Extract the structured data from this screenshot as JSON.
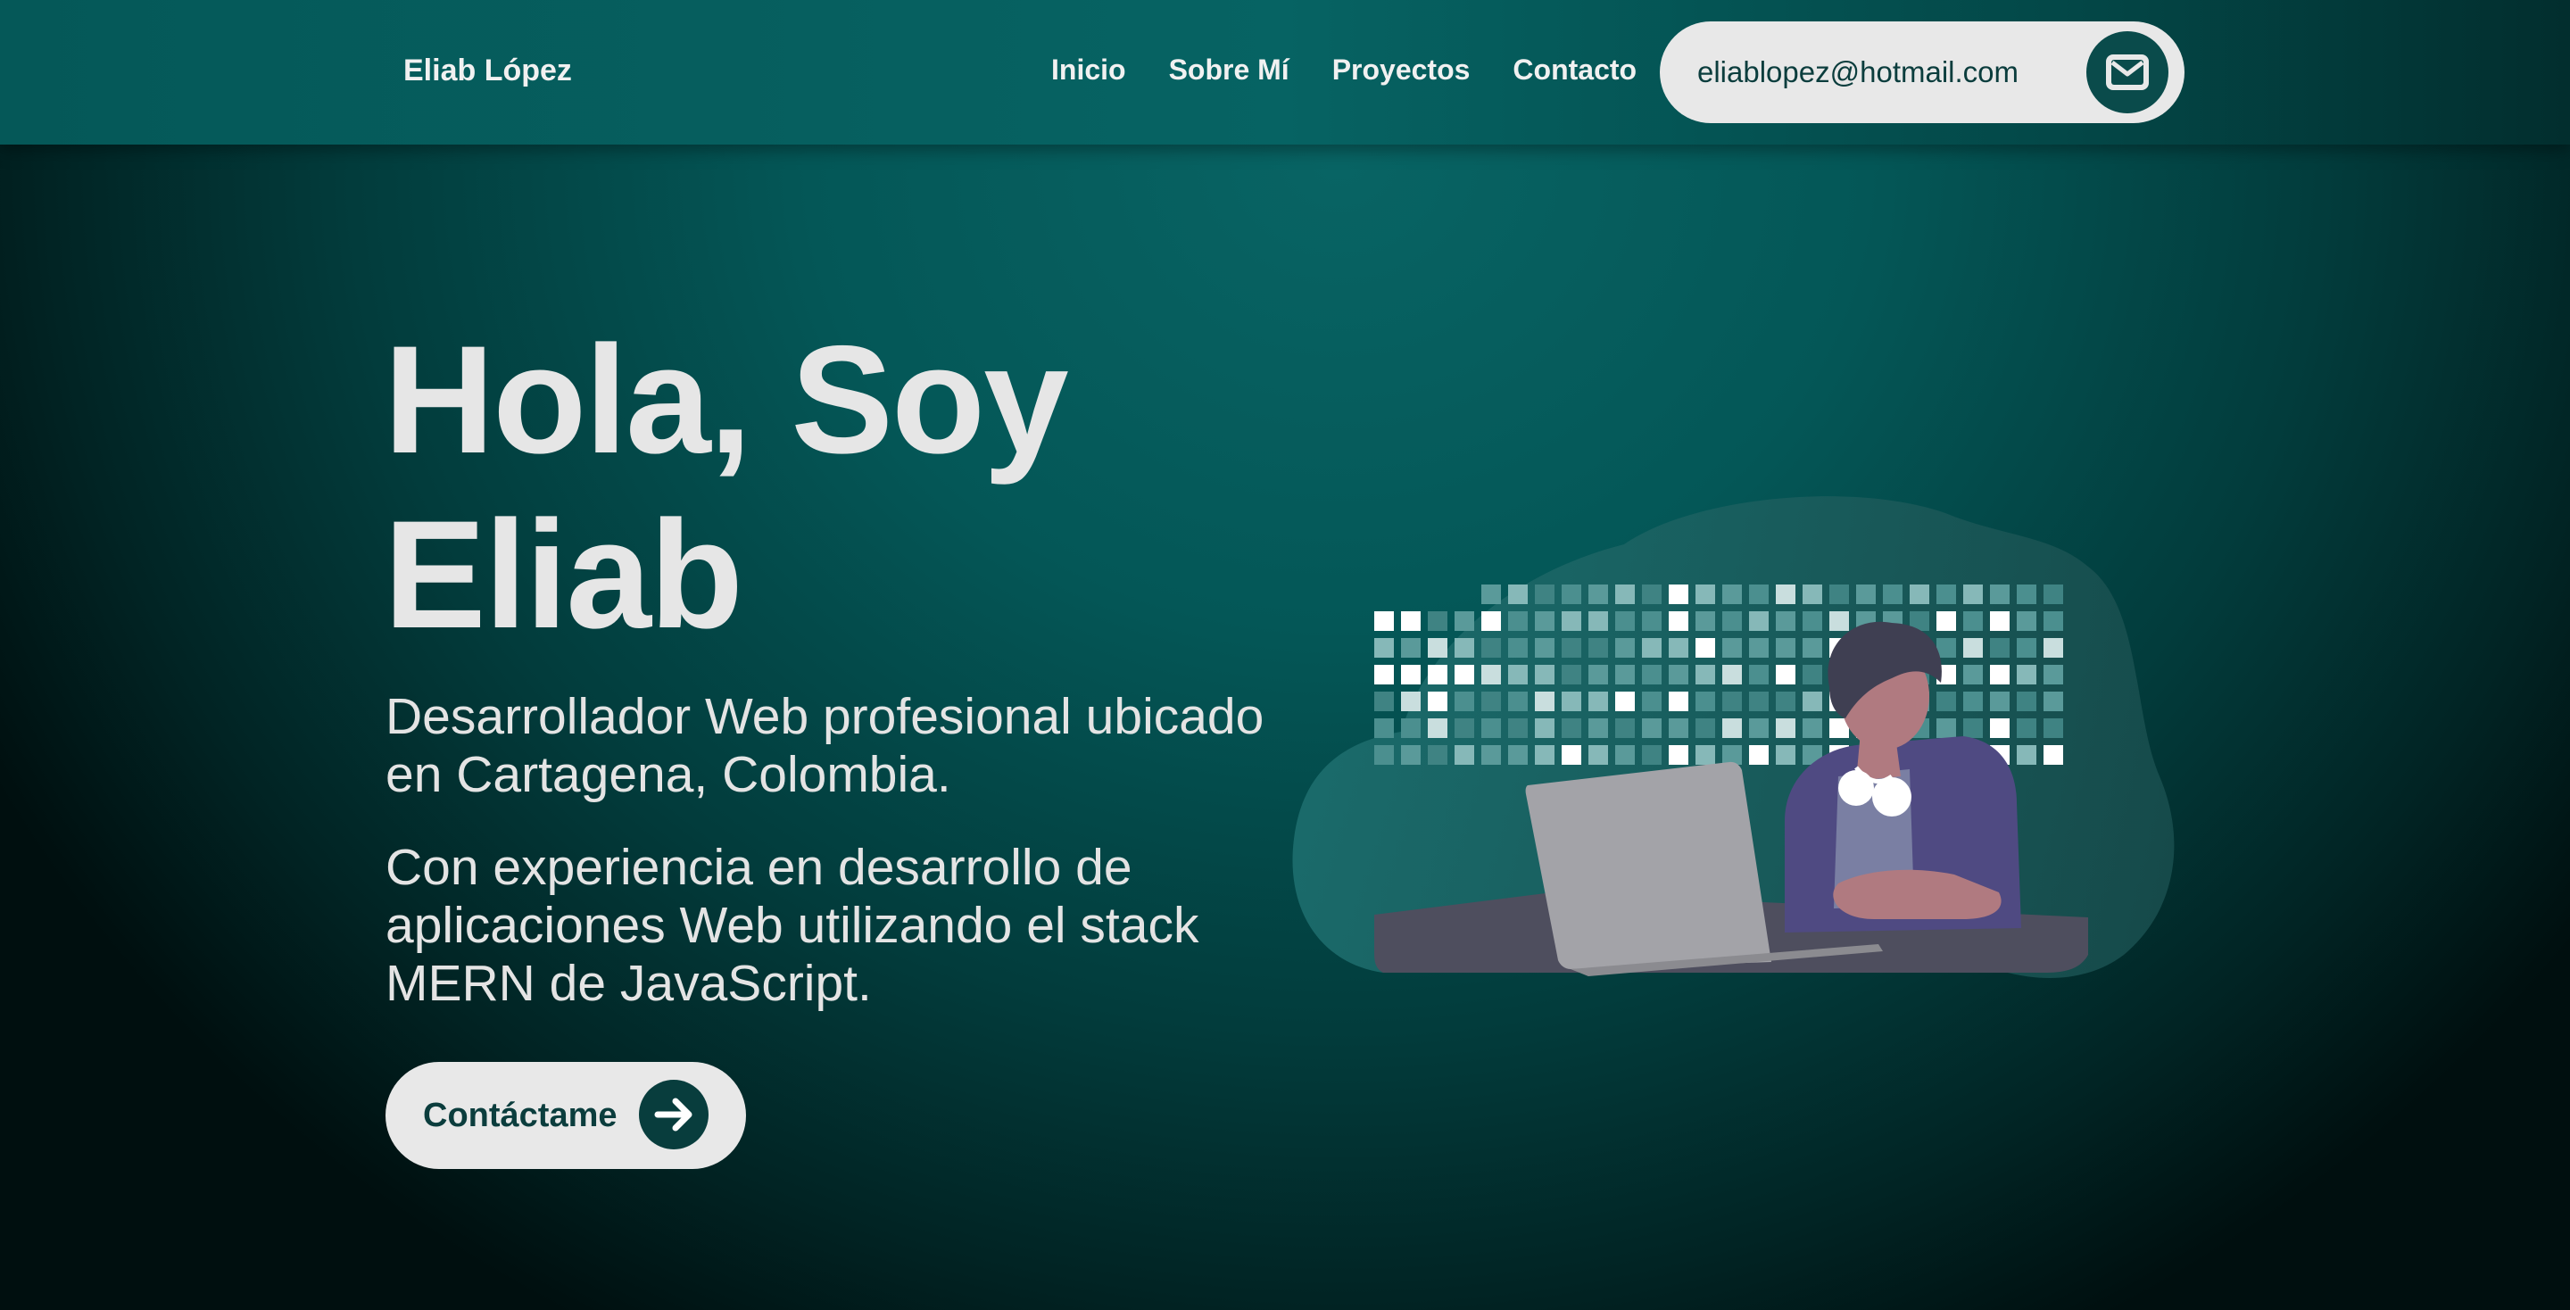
{
  "nav": {
    "brand": "Eliab López",
    "links": [
      "Inicio",
      "Sobre Mí",
      "Proyectos",
      "Contacto"
    ],
    "email": "eliablopez@hotmail.com",
    "email_icon": "envelope-icon"
  },
  "hero": {
    "title_line1": "Hola, Soy",
    "title_line2": "Eliab",
    "paragraph1": "Desarrollador Web profesional ubicado en Cartagena, Colombia.",
    "paragraph2": "Con experiencia en desarrollo de aplicaciones Web utilizando el stack MERN de JavaScript.",
    "cta_label": "Contáctame",
    "cta_icon": "arrow-right-icon"
  },
  "colors": {
    "background": "#045757",
    "pill_background": "#e8e8e8",
    "dark_accent": "#0a4b4b",
    "text_light": "#e6e6e6"
  }
}
